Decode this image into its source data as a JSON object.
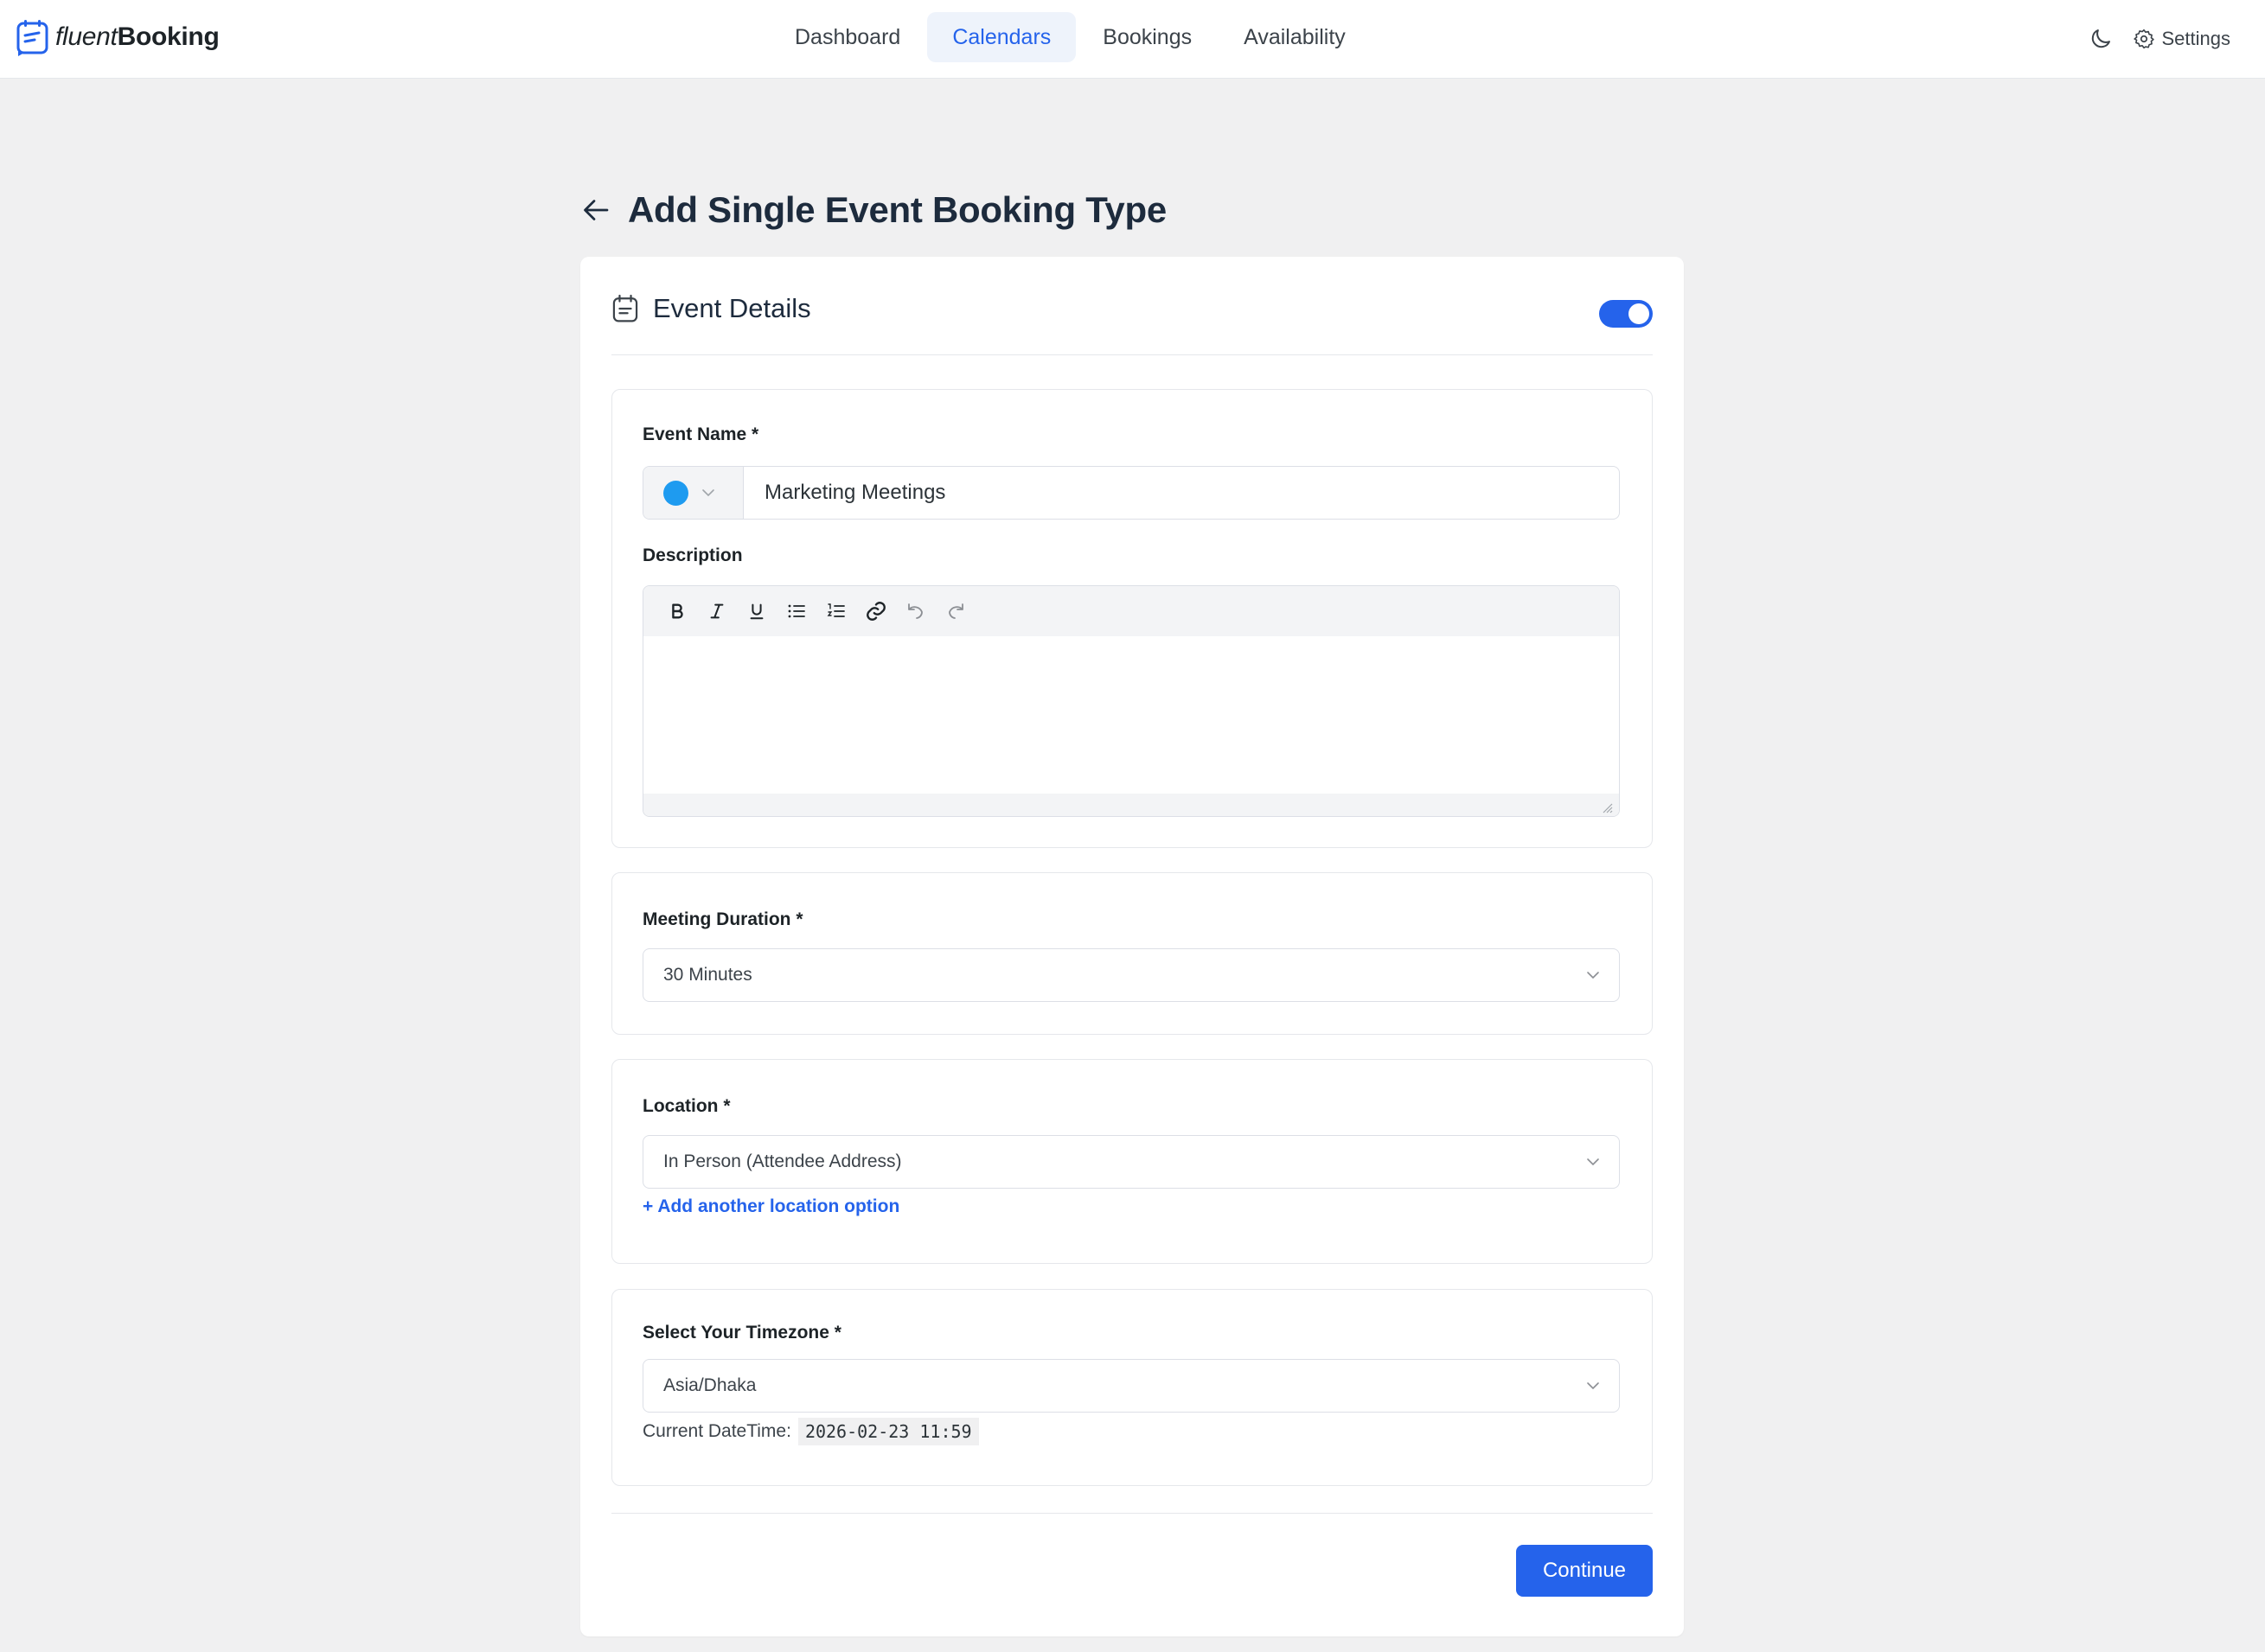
{
  "brand": {
    "name_light": "fluent",
    "name_bold": "Booking"
  },
  "nav": {
    "items": [
      {
        "label": "Dashboard",
        "active": false
      },
      {
        "label": "Calendars",
        "active": true
      },
      {
        "label": "Bookings",
        "active": false
      },
      {
        "label": "Availability",
        "active": false
      }
    ]
  },
  "topright": {
    "settings_label": "Settings"
  },
  "page": {
    "title": "Add Single Event Booking Type"
  },
  "card": {
    "title": "Event Details",
    "enabled": true,
    "event_name": {
      "label": "Event Name *",
      "color": "#1e9bf0",
      "value": "Marketing Meetings"
    },
    "description": {
      "label": "Description",
      "toolbar": [
        "bold-icon",
        "italic-icon",
        "underline-icon",
        "bullet-list-icon",
        "numbered-list-icon",
        "link-icon",
        "undo-icon",
        "redo-icon"
      ],
      "value": ""
    },
    "duration": {
      "label": "Meeting Duration *",
      "value": "30 Minutes"
    },
    "location": {
      "label": "Location *",
      "value": "In Person (Attendee Address)",
      "add_label": "+ Add another location option"
    },
    "timezone": {
      "label": "Select Your Timezone *",
      "value": "Asia/Dhaka",
      "current_label": "Current DateTime:",
      "current_value": "2026-02-23 11:59"
    },
    "continue_label": "Continue"
  },
  "colors": {
    "accent": "#2563eb",
    "background": "#f0f0f1"
  }
}
